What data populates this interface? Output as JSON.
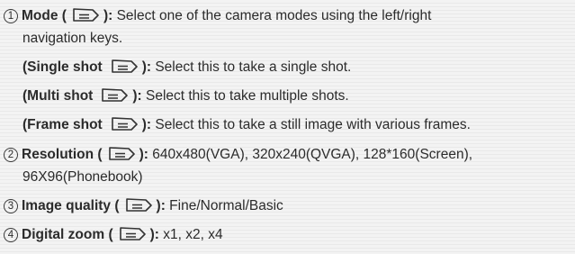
{
  "items": [
    {
      "num": "1",
      "label": "Mode (",
      "close": "):",
      "desc": "Select one of the camera modes using the left/right",
      "desc2": "navigation keys."
    },
    {
      "label": "(Single shot",
      "close": "):",
      "desc": "Select this to take a single shot."
    },
    {
      "label": "(Multi shot",
      "close": "):",
      "desc": "Select this to take multiple shots."
    },
    {
      "label": "(Frame shot",
      "close": "):",
      "desc": "Select this to take a still image with various frames."
    },
    {
      "num": "2",
      "label": "Resolution (",
      "close": "):",
      "desc": "640x480(VGA), 320x240(QVGA), 128*160(Screen),",
      "desc2": "96X96(Phonebook)"
    },
    {
      "num": "3",
      "label": "Image quality (",
      "close": "):",
      "desc": "Fine/Normal/Basic"
    },
    {
      "num": "4",
      "label": "Digital zoom (",
      "close": "):",
      "desc": "x1, x2, x4"
    }
  ],
  "icons": {
    "key": "soft-key-icon"
  }
}
